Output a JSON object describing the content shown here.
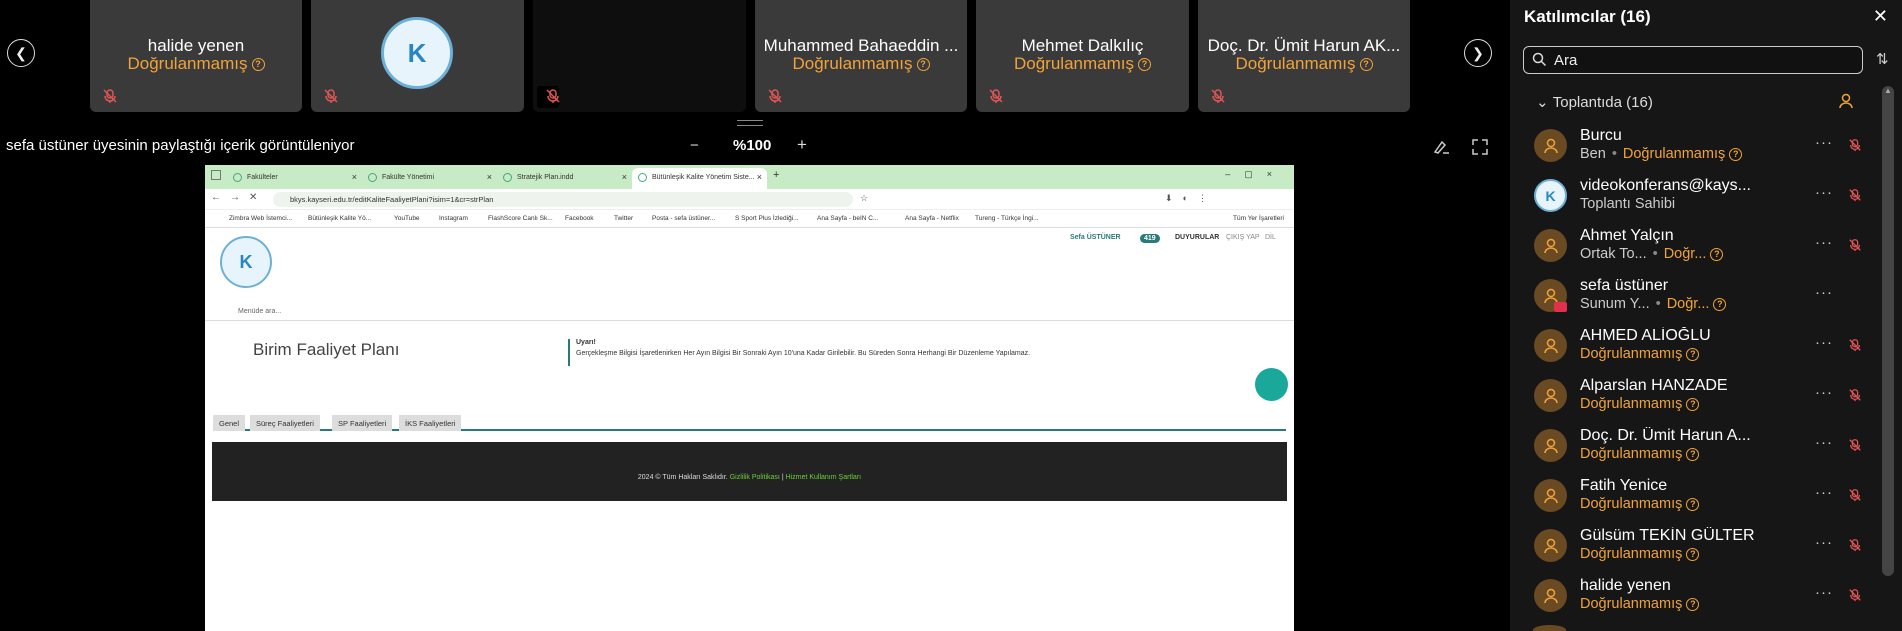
{
  "strip": {
    "tiles": [
      {
        "name": "halide yenen",
        "status": "Doğrulanmamış"
      },
      {
        "name": "",
        "status": ""
      },
      {
        "name": "",
        "status": ""
      },
      {
        "name": "Muhammed Bahaeddin ...",
        "status": "Doğrulanmamış"
      },
      {
        "name": "Mehmet Dalkılıç",
        "status": "Doğrulanmamış"
      },
      {
        "name": "Doç. Dr. Ümit Harun AK...",
        "status": "Doğrulanmamış"
      }
    ],
    "qmark": "?"
  },
  "share": {
    "caption": "sefa üstüner üyesinin paylaştığı içerik görüntüleniyor",
    "zoom": "%100",
    "zoom_out": "−",
    "zoom_in": "+"
  },
  "browser": {
    "tabs": [
      "Fakülteler",
      "Fakülte Yönetimi",
      "Stratejik Plan.indd",
      "Bütünleşik Kalite Yönetim Siste..."
    ],
    "new_tab": "+",
    "url": "bkys.kayseri.edu.tr/editKaliteFaaliyetPlani?isim=1&cr=strPlan",
    "bookmarks": [
      "Zimbra Web İstemci...",
      "Bütünleşik Kalite Yö...",
      "YouTube",
      "Instagram",
      "FlashScore Canlı Sk...",
      "Facebook",
      "Twitter",
      "Posta - sefa üstüner...",
      "S Sport Plus İzlediği...",
      "Ana Sayfa - beIN C...",
      "Ana Sayfa - Netflix",
      "Tureng - Türkçe İngi..."
    ],
    "bookmarks_all": "Tüm Yer İşaretleri"
  },
  "site": {
    "logo": "K",
    "search": "Menüde ara...",
    "user": "Sefa",
    "user_last": "ÜSTÜNER",
    "badge": "419",
    "menu": [
      "DUYURULAR",
      "ÇIKIŞ YAP",
      "DİL"
    ],
    "title": "Birim Faaliyet Planı",
    "warning_title": "Uyarı!",
    "warning_text": "Gerçekleşme Bilgisi İşaretlenirken Her Ayın Bilgisi Bir Sonraki Ayın 10'una Kadar Girilebilir. Bu Süreden Sonra Herhangi Bir Düzenleme Yapılamaz.",
    "subtabs": [
      "Genel",
      "Süreç Faaliyetleri",
      "SP Faaliyetleri",
      "İKS Faaliyetleri"
    ],
    "footer_copy": "2024 © Tüm Hakları Saklıdır.",
    "footer_privacy": "Gizlilik Politikası",
    "footer_sep": "|",
    "footer_terms": "Hizmet Kullanım Şartları"
  },
  "panel": {
    "title": "Katılımcılar (16)",
    "search_placeholder": "Ara",
    "section": "Toplantıda (16)",
    "more": "···",
    "participants": [
      {
        "name": "Burcu",
        "role": "Ben",
        "status": "Doğrulanmamış"
      },
      {
        "name": "videokonferans@kays...",
        "role": "Toplantı Sahibi",
        "status": ""
      },
      {
        "name": "Ahmet Yalçın",
        "role": "Ortak To...",
        "status": "Doğr..."
      },
      {
        "name": "sefa üstüner",
        "role": "Sunum Y...",
        "status": "Doğr..."
      },
      {
        "name": "AHMED ALİOĞLU",
        "role": "",
        "status": "Doğrulanmamış"
      },
      {
        "name": "Alparslan HANZADE",
        "role": "",
        "status": "Doğrulanmamış"
      },
      {
        "name": "Doç. Dr. Ümit Harun A...",
        "role": "",
        "status": "Doğrulanmamış"
      },
      {
        "name": "Fatih Yenice",
        "role": "",
        "status": "Doğrulanmamış"
      },
      {
        "name": "Gülsüm TEKİN GÜLTER",
        "role": "",
        "status": "Doğrulanmamış"
      },
      {
        "name": "halide yenen",
        "role": "",
        "status": "Doğrulanmamış"
      }
    ]
  }
}
